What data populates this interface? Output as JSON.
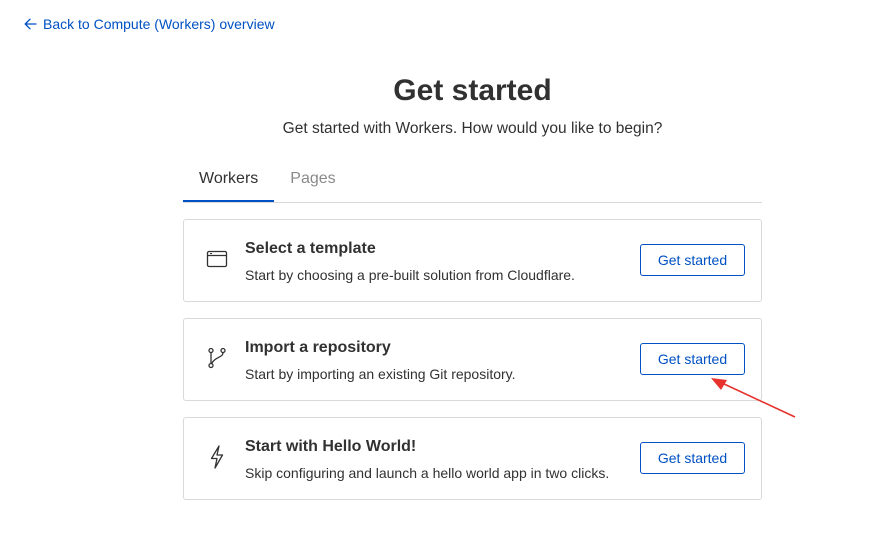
{
  "back_link": {
    "label": "Back to Compute (Workers) overview",
    "icon": "arrow-left-icon"
  },
  "header": {
    "title": "Get started",
    "subtitle": "Get started with Workers. How would you like to begin?"
  },
  "tabs": [
    {
      "label": "Workers",
      "active": true
    },
    {
      "label": "Pages",
      "active": false
    }
  ],
  "options": [
    {
      "icon": "browser-window-icon",
      "title": "Select a template",
      "description": "Start by choosing a pre-built solution from Cloudflare.",
      "button_label": "Get started"
    },
    {
      "icon": "git-branch-icon",
      "title": "Import a repository",
      "description": "Start by importing an existing Git repository.",
      "button_label": "Get started"
    },
    {
      "icon": "lightning-bolt-icon",
      "title": "Start with Hello World!",
      "description": "Skip configuring and launch a hello world app in two clicks.",
      "button_label": "Get started"
    }
  ],
  "colors": {
    "link": "#0051c3",
    "text": "#313131",
    "border": "#d9d9d9",
    "annotation_arrow": "#e8322d"
  }
}
